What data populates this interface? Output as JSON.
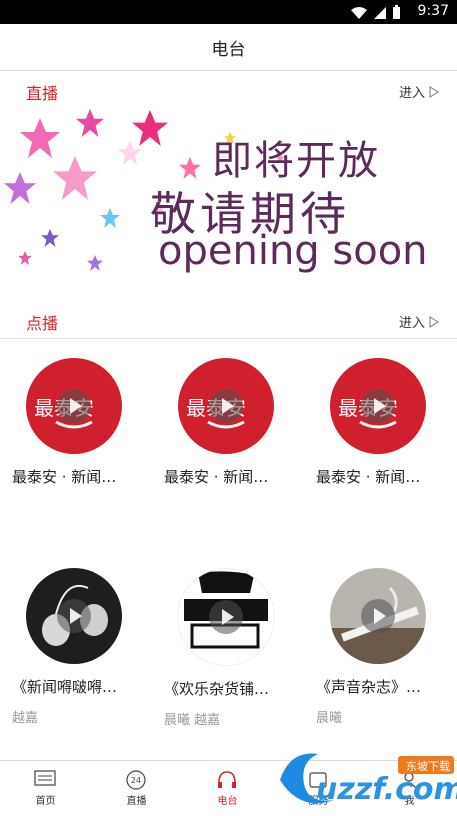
{
  "status_bar": {
    "time": "9:37"
  },
  "header": {
    "title": "电台"
  },
  "live_section": {
    "title": "直播",
    "enter": "进入"
  },
  "banner": {
    "line1": "即将开放",
    "line2": "敬请期待",
    "line3": "opening soon"
  },
  "vod_section": {
    "title": "点播",
    "enter": "进入"
  },
  "items": [
    {
      "name": "最泰安 · 新闻…",
      "author": "",
      "cover": "logo-red"
    },
    {
      "name": "最泰安 · 新闻…",
      "author": "",
      "cover": "logo-red"
    },
    {
      "name": "最泰安 · 新闻…",
      "author": "",
      "cover": "logo-red"
    },
    {
      "name": "《新闻嘚啵嘚…",
      "author": "越嘉",
      "cover": "earphones"
    },
    {
      "name": "《欢乐杂货铺…",
      "author": "晨曦 越嘉",
      "cover": "shop-sign"
    },
    {
      "name": "《声音杂志》…",
      "author": "晨曦",
      "cover": "cigarette"
    }
  ],
  "logo_text": "最泰安",
  "tabs": [
    {
      "label": "首页",
      "icon": "news-icon"
    },
    {
      "label": "直播",
      "icon": "clock-24-icon"
    },
    {
      "label": "电台",
      "icon": "headphones-icon",
      "active": true
    },
    {
      "label": "服务",
      "icon": "service-icon"
    },
    {
      "label": "我",
      "icon": "user-icon"
    }
  ],
  "colors": {
    "accent": "#d9242f",
    "logo_red": "#d0202e"
  },
  "watermark": {
    "text": "uzzf.com",
    "badge": "东坡下载"
  }
}
